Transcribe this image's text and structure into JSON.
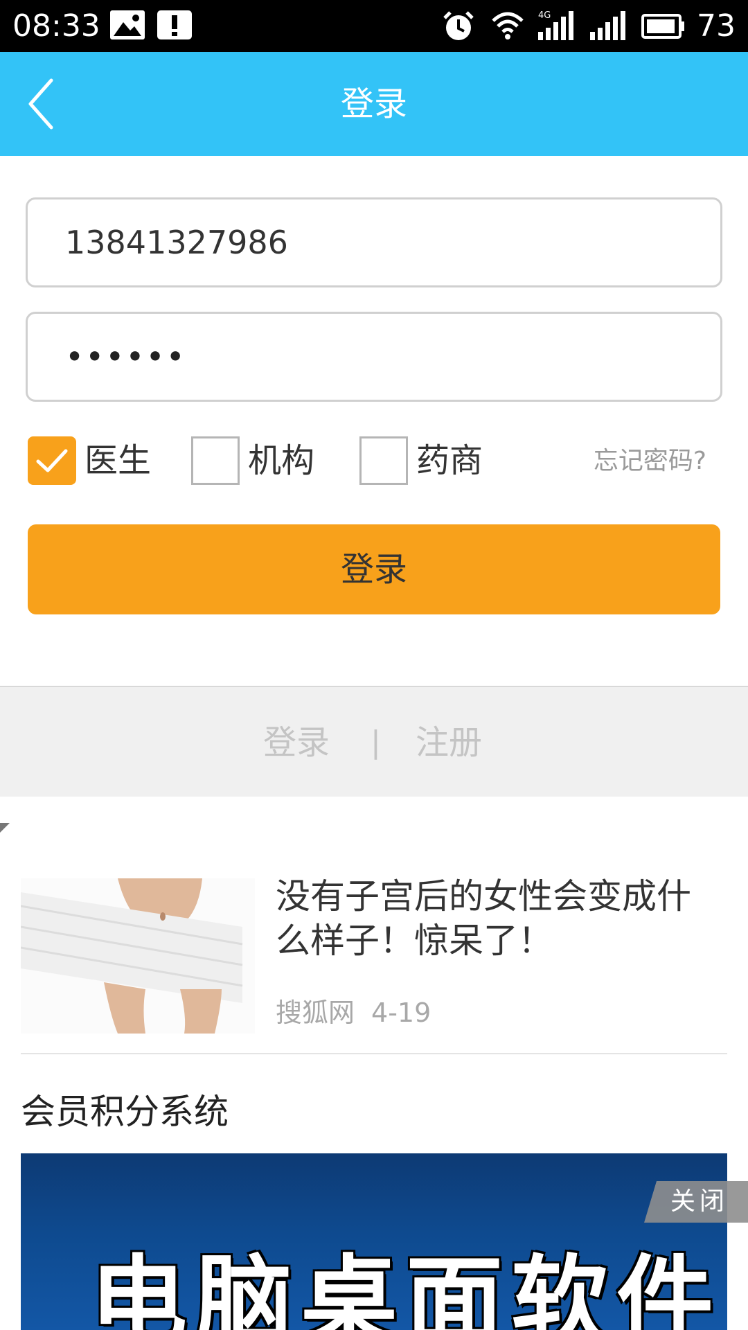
{
  "status_bar": {
    "time": "08:33",
    "network": "4G",
    "battery": "73",
    "icons": [
      "image-icon",
      "alert-icon",
      "alarm-icon",
      "wifi-icon",
      "signal-4g-icon",
      "signal-icon",
      "battery-icon"
    ]
  },
  "app_bar": {
    "title": "登录",
    "back_icon": "chevron-left-icon",
    "color": "#33c3f7"
  },
  "form": {
    "phone_value": "13841327986",
    "password_value": "••••••",
    "roles": [
      {
        "label": "医生",
        "checked": true
      },
      {
        "label": "机构",
        "checked": false
      },
      {
        "label": "药商",
        "checked": false
      }
    ],
    "forgot_label": "忘记密码?",
    "login_label": "登录",
    "accent": "#f8a11b"
  },
  "auth_bar": {
    "login": "登录",
    "separator": "|",
    "register": "注册"
  },
  "news": {
    "title": "没有子宫后的女性会变成什么样子！惊呆了！",
    "source": "搜狐网",
    "date": "4-19"
  },
  "section": {
    "title": "会员积分系统"
  },
  "ad": {
    "close_label": "关闭",
    "text": "电脑桌面软件"
  }
}
